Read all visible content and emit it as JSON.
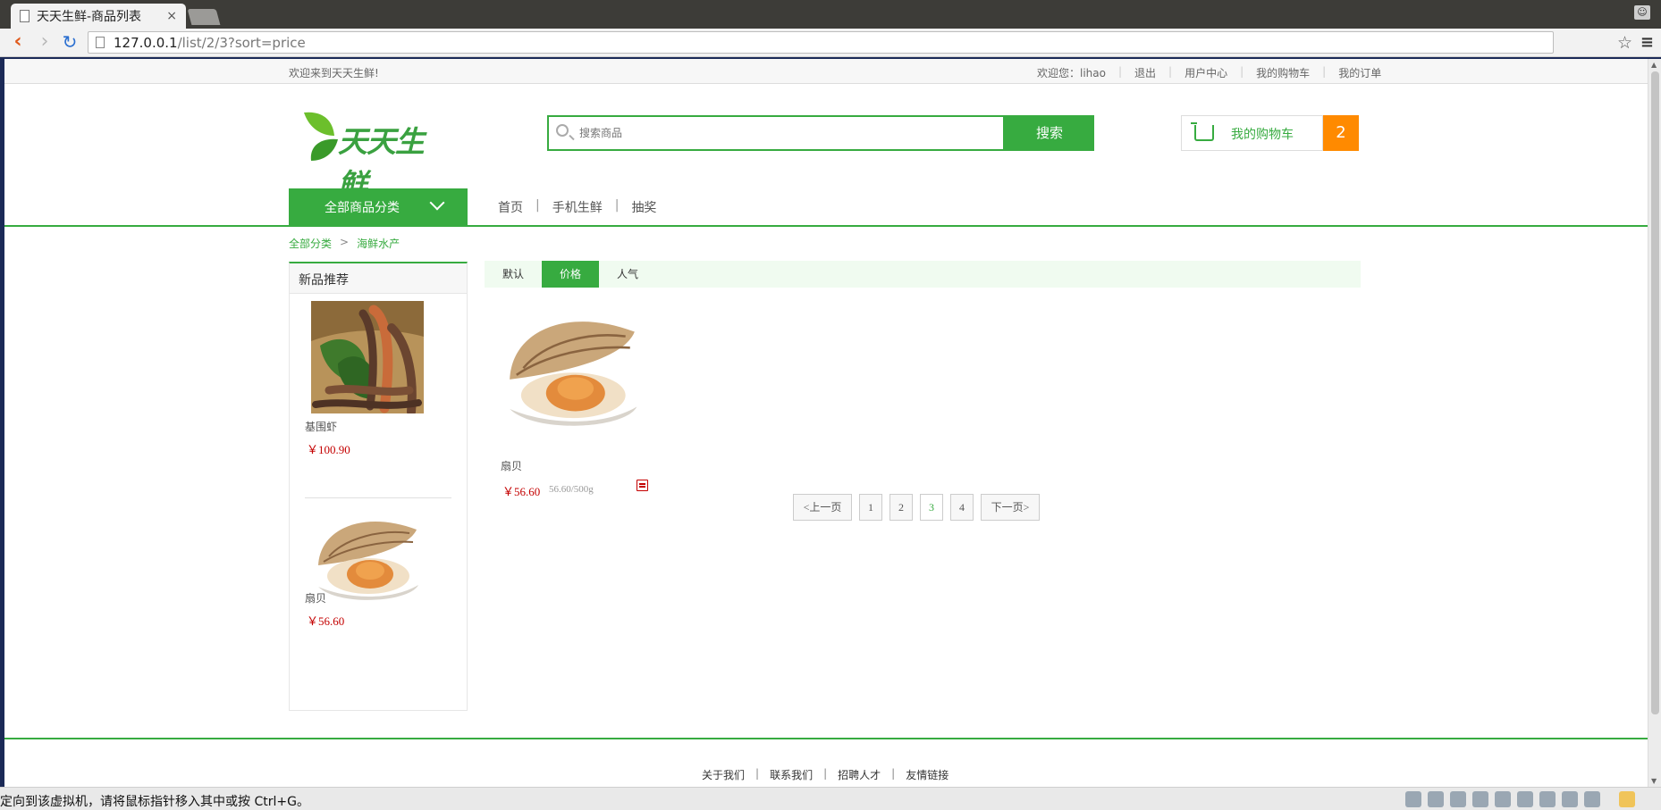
{
  "browser": {
    "tab_title": "天天生鲜-商品列表",
    "tab_close": "×",
    "url_host": "127.0.0.1",
    "url_path": "/list/2/3?sort=price"
  },
  "site": {
    "welcome": "欢迎来到天天生鲜!",
    "user_links": [
      "欢迎您：lihao",
      "退出",
      "用户中心",
      "我的购物车",
      "我的订单"
    ],
    "logo_text": "天天生鲜",
    "search_placeholder": "搜索商品",
    "search_button": "搜索",
    "cart_label": "我的购物车",
    "cart_count": "2",
    "all_categories": "全部商品分类",
    "nav": [
      "首页",
      "手机生鲜",
      "抽奖"
    ],
    "nav_sep": "|",
    "breadcrumb": [
      "全部分类",
      "海鲜水产"
    ],
    "breadcrumb_sep": ">"
  },
  "sidebar": {
    "title": "新品推荐",
    "items": [
      {
        "name": "基围虾",
        "price": "￥100.90"
      },
      {
        "name": "扇贝",
        "price": "￥56.60"
      }
    ]
  },
  "sort_tabs": [
    {
      "label": "默认",
      "active": false
    },
    {
      "label": "价格",
      "active": true
    },
    {
      "label": "人气",
      "active": false
    }
  ],
  "goods": [
    {
      "name": "扇贝",
      "price": "￥56.60",
      "unit": "56.60/500g"
    }
  ],
  "pagination": {
    "prev": "<上一页",
    "pages": [
      "1",
      "2",
      "3",
      "4"
    ],
    "current": "3",
    "next": "下一页>"
  },
  "footer": {
    "links": [
      "关于我们",
      "联系我们",
      "招聘人才",
      "友情链接"
    ],
    "sep": "|"
  },
  "status_bar": {
    "message": "定向到该虚拟机，请将鼠标指针移入其中或按 Ctrl+G。"
  },
  "colors": {
    "brand_green": "#37ab40",
    "cart_orange": "#ff8a00",
    "price_red": "#c40000"
  }
}
